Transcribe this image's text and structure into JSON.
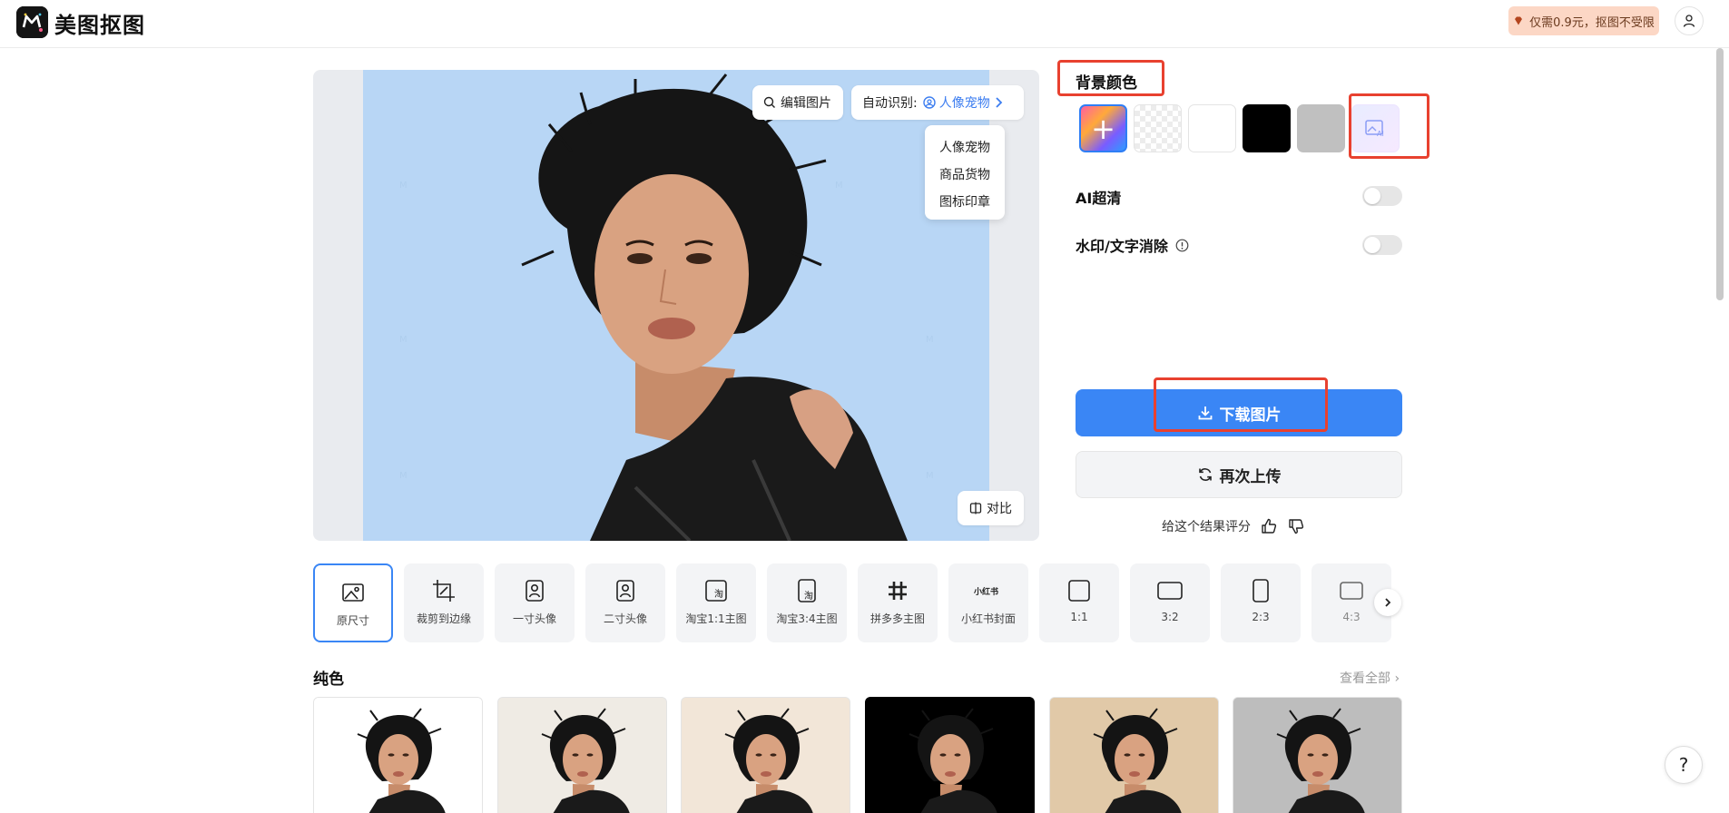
{
  "header": {
    "brand": "美图抠图",
    "promo": "仅需0.9元，抠图不受限"
  },
  "preview": {
    "edit_label": "编辑图片",
    "auto_label": "自动识别:",
    "auto_value": "人像宠物",
    "dropdown": [
      "人像宠物",
      "商品货物",
      "图标印章"
    ],
    "compare_label": "对比",
    "background_color": "#b8d6f5"
  },
  "panel": {
    "bg_title": "背景颜色",
    "swatches": [
      {
        "name": "add-custom",
        "color": ""
      },
      {
        "name": "transparent",
        "color": ""
      },
      {
        "name": "white",
        "color": "#ffffff"
      },
      {
        "name": "black",
        "color": "#000000"
      },
      {
        "name": "gray",
        "color": "#c0c0c0"
      },
      {
        "name": "ai-background",
        "color": ""
      }
    ],
    "ai_hd_label": "AI超清",
    "watermark_label": "水印/文字消除",
    "download_label": "下载图片",
    "reupload_label": "再次上传",
    "rate_label": "给这个结果评分"
  },
  "presets": [
    {
      "label": "原尺寸",
      "icon": "image-icon"
    },
    {
      "label": "裁剪到边缘",
      "icon": "crop-icon"
    },
    {
      "label": "一寸头像",
      "icon": "portrait-icon"
    },
    {
      "label": "二寸头像",
      "icon": "portrait-icon"
    },
    {
      "label": "淘宝1:1主图",
      "icon": "taobao-icon"
    },
    {
      "label": "淘宝3:4主图",
      "icon": "taobao-icon"
    },
    {
      "label": "拼多多主图",
      "icon": "pinduoduo-icon"
    },
    {
      "label": "小红书封面",
      "icon": "xiaohongshu-icon"
    },
    {
      "label": "1:1",
      "icon": "ratio-icon"
    },
    {
      "label": "3:2",
      "icon": "ratio-icon"
    },
    {
      "label": "2:3",
      "icon": "ratio-icon"
    },
    {
      "label": "4:3",
      "icon": "ratio-icon"
    }
  ],
  "presets_extra": {
    "taobao_glyph": "淘",
    "xhs_glyph": "小红书"
  },
  "solid": {
    "title": "纯色",
    "view_all": "查看全部",
    "colors": [
      "#ffffff",
      "#efebe4",
      "#f2e6d8",
      "#000000",
      "#e1c9a8",
      "#bdbdbd"
    ]
  },
  "help": "?"
}
